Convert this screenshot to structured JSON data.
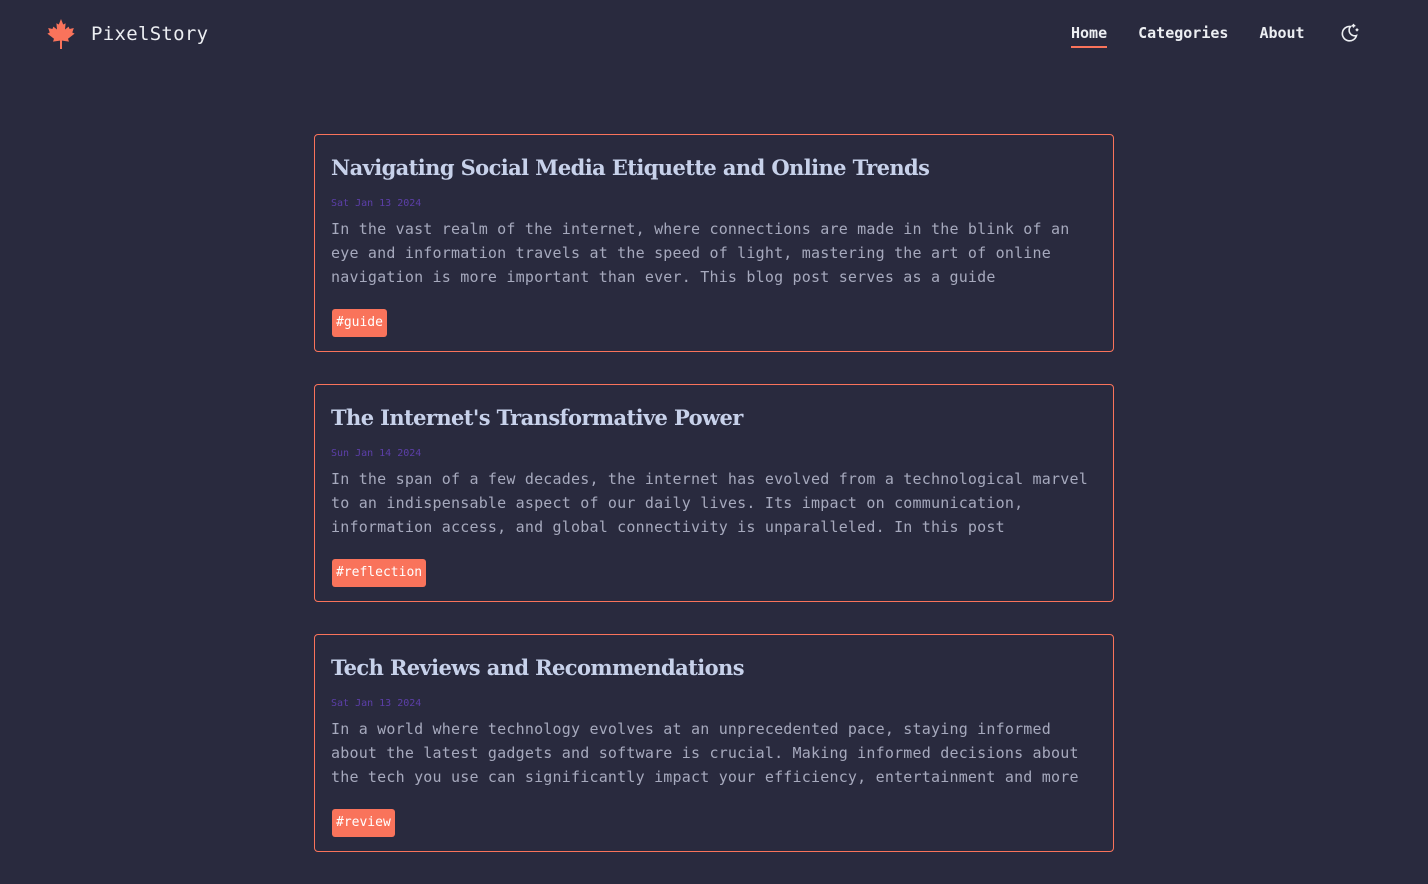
{
  "brand": {
    "name": "PixelStory",
    "logo_icon": "maple-leaf-icon",
    "accent_color": "#f9735b"
  },
  "nav": {
    "items": [
      {
        "label": "Home",
        "active": true
      },
      {
        "label": "Categories",
        "active": false
      },
      {
        "label": "About",
        "active": false
      }
    ],
    "theme_toggle_icon": "moon-icon"
  },
  "posts": [
    {
      "title": "Navigating Social Media Etiquette and Online Trends",
      "date": "Sat Jan 13 2024",
      "excerpt": "In the vast realm of the internet, where connections are made in the blink of an eye and information travels at the speed of light, mastering the art of online navigation is more important than ever. This blog post serves as a guide",
      "tag": "#guide"
    },
    {
      "title": "The Internet's Transformative Power",
      "date": "Sun Jan 14 2024",
      "excerpt": "In the span of a few decades, the internet has evolved from a technological marvel to an indispensable aspect of our daily lives. Its impact on communication, information access, and global connectivity is unparalleled. In this post",
      "tag": "#reflection"
    },
    {
      "title": "Tech Reviews and Recommendations",
      "date": "Sat Jan 13 2024",
      "excerpt": "In a world where technology evolves at an unprecedented pace, staying informed about the latest gadgets and software is crucial. Making informed decisions about the tech you use can significantly impact your efficiency, entertainment and more",
      "tag": "#review"
    }
  ]
}
